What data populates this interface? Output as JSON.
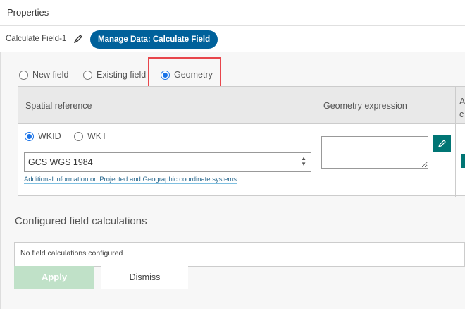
{
  "header": {
    "title": "Properties"
  },
  "tool": {
    "name": "Calculate Field-1",
    "badge": "Manage Data: Calculate Field"
  },
  "mode_options": [
    {
      "label": "New field",
      "selected": false
    },
    {
      "label": "Existing field",
      "selected": false
    },
    {
      "label": "Geometry",
      "selected": true
    }
  ],
  "table": {
    "headers": [
      "Spatial reference",
      "Geometry expression",
      "A",
      "c"
    ],
    "ref_options": [
      {
        "label": "WKID",
        "selected": true
      },
      {
        "label": "WKT",
        "selected": false
      }
    ],
    "spatial_reference_value": "GCS WGS 1984",
    "info_link": "Additional information on Projected and Geographic coordinate systems",
    "expression_value": ""
  },
  "configured": {
    "title": "Configured field calculations",
    "empty_text": "No field calculations configured"
  },
  "buttons": {
    "apply": "Apply",
    "dismiss": "Dismiss"
  },
  "colors": {
    "badge": "#00619b",
    "accent": "#007574",
    "highlight": "#e8464c",
    "apply_disabled": "#c0e1c8"
  }
}
